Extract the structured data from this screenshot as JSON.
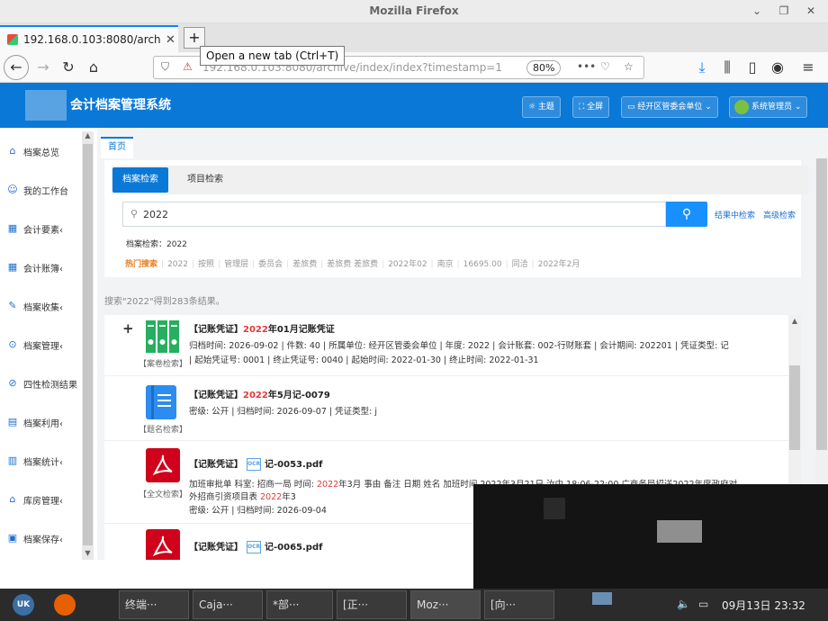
{
  "browser": {
    "window_title": "Mozilla Firefox",
    "tab_title": "192.168.0.103:8080/archive",
    "tooltip": "Open a new tab (Ctrl+T)",
    "url": "192.168.0.103:8080/archive/index/index?timestamp=1",
    "zoom": "80%"
  },
  "app": {
    "title": "会计档案管理系统",
    "header_buttons": {
      "theme": "☼ 主题",
      "fullscreen": "⛶ 全屏",
      "unit": "▭ 经开区管委会单位 ⌄",
      "user": "系统管理员 ⌄"
    }
  },
  "sidebar": {
    "items": [
      {
        "icon": "home-icon",
        "label": "档案总览"
      },
      {
        "icon": "user-icon",
        "label": "我的工作台"
      },
      {
        "icon": "grid-icon",
        "label": "会计要素‹"
      },
      {
        "icon": "grid-icon",
        "label": "会计账簿‹"
      },
      {
        "icon": "edit-icon",
        "label": "档案收集‹"
      },
      {
        "icon": "archive-icon",
        "label": "档案管理‹"
      },
      {
        "icon": "check-icon",
        "label": "四性检测结果"
      },
      {
        "icon": "doc-icon",
        "label": "档案利用‹"
      },
      {
        "icon": "chart-icon",
        "label": "档案统计‹"
      },
      {
        "icon": "warehouse-icon",
        "label": "库房管理‹"
      },
      {
        "icon": "save-icon",
        "label": "档案保存‹"
      }
    ]
  },
  "main": {
    "page_tab": "首页",
    "search_tabs": {
      "active": "档案检索",
      "other": "项目检索"
    },
    "search": {
      "value": "2022",
      "result_search": "结果中检索",
      "advanced": "高级检索",
      "crumb": "档案检索：2022"
    },
    "hot": {
      "label": "热门搜索",
      "terms": [
        "2022",
        "按照",
        "管理层",
        "委员会",
        "差旅费",
        "差旅费 差旅费",
        "2022年02",
        "南京",
        "16695.00",
        "同洽",
        "2022年2月"
      ]
    },
    "count_text": "搜索\"2022\"得到283条结果。",
    "results": [
      {
        "tag": "【案卷检索】",
        "title_prefix": "【记账凭证】",
        "title_red": "2022",
        "title_rest": "年01月记账凭证",
        "meta1": "归档时间: 2026-09-02 | 件数: 40 | 所属单位: 经开区管委会单位 | 年度: 2022 | 会计账套: 002-行财账套 | 会计期间: 202201 | 凭证类型: 记",
        "meta2": "| 起始凭证号: 0001 | 终止凭证号: 0040 | 起始时间: 2022-01-30 | 终止时间: 2022-01-31"
      },
      {
        "tag": "【题名检索】",
        "title_prefix": "【记账凭证】",
        "title_red": "2022",
        "title_rest": "年5月记-0079",
        "meta1": "密级: 公开 | 归档时间: 2026-09-07 | 凭证类型: j"
      },
      {
        "tag": "【全文检索】",
        "title_prefix": "【记账凭证】",
        "title_rest": "记-0053.pdf",
        "ocr": "OCR",
        "meta1_a": "加班审批单 科室: 招商一局 时间: ",
        "meta1_red": "2022",
        "meta1_b": "年3月 事由 备注 日期 姓名 加班时间 2022年3月21日 汝中 18:06-22:00 广商务局招送2022年度政府对",
        "meta2_a": "外招商引资项目表 ",
        "meta2_red": "2022",
        "meta2_b": "年3",
        "meta3": "密级: 公开 | 归档时间: 2026-09-04"
      },
      {
        "title_prefix": "【记账凭证】",
        "title_rest": "记-0065.pdf",
        "ocr": "OCR"
      }
    ]
  },
  "taskbar": {
    "items": [
      "终端···",
      "Caja···",
      "*部···",
      "[正···",
      "Moz···",
      "[向···"
    ],
    "clock": "09月13日 23:32"
  }
}
